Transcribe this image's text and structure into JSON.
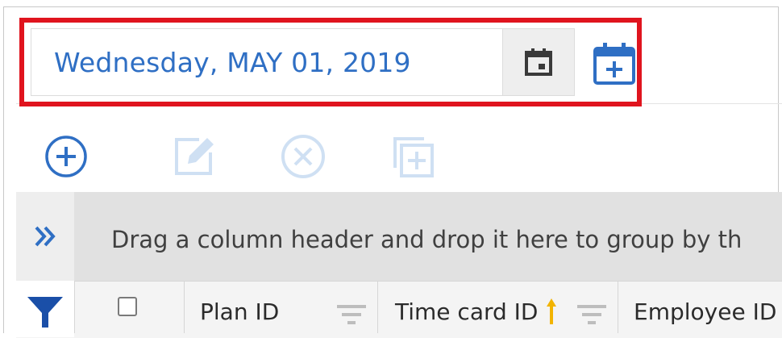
{
  "date_picker": {
    "value": "Wednesday, MAY 01, 2019",
    "icons": {
      "calendar": "calendar-icon",
      "add_calendar": "calendar-add-icon"
    }
  },
  "toolbar": {
    "icons": [
      "add-circle-icon",
      "edit-icon",
      "delete-circle-icon",
      "copy-add-icon"
    ]
  },
  "grid": {
    "group_panel_text": "Drag a column header and drop it here to group by th",
    "columns": [
      {
        "label": "Plan ID"
      },
      {
        "label": "Time card ID"
      },
      {
        "label": "Employee ID"
      }
    ]
  },
  "colors": {
    "accent": "#2f6fc4",
    "highlight": "#e0141e",
    "disabled_icon": "#cfe0f3",
    "sort_indicator": "#f2b400"
  }
}
